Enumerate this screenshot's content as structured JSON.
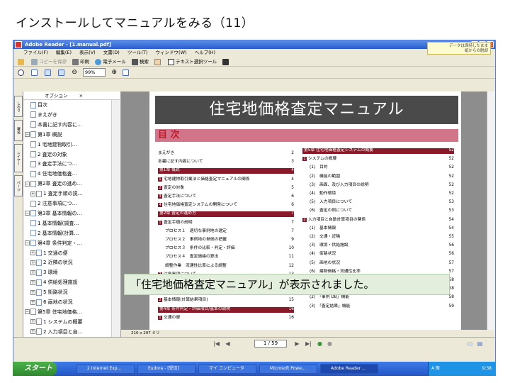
{
  "heading": "インストールしてマニュアルをみる（11）",
  "window": {
    "title": "Adobe Reader - [1.manual.pdf]",
    "menu": [
      "ファイル(F)",
      "編集(E)",
      "表示(V)",
      "文書(D)",
      "ツール(T)",
      "ウィンドウ(W)",
      "ヘルプ(H)"
    ],
    "toolbar1": [
      "コピーを保存",
      "印刷",
      "電子メール",
      "検索",
      "テキスト選択ツール"
    ],
    "zoom": "99%",
    "data_note": "データは保持したまま\n紙からの脱却",
    "options_label": "オプション",
    "vertical_tabs": [
      "しおり",
      "署名",
      "レイヤー",
      "ページ"
    ]
  },
  "bookmarks": [
    {
      "label": "目次",
      "level": 1,
      "expander": ""
    },
    {
      "label": "まえがき",
      "level": 1,
      "expander": ""
    },
    {
      "label": "本書に記す内容に…",
      "level": 1,
      "expander": ""
    },
    {
      "label": "第1章 概説",
      "level": 0,
      "expander": "⊟"
    },
    {
      "label": "1 宅地建物取引…",
      "level": 1,
      "expander": ""
    },
    {
      "label": "2 査定の対象",
      "level": 1,
      "expander": ""
    },
    {
      "label": "3 査定手法につ…",
      "level": 1,
      "expander": ""
    },
    {
      "label": "4 住宅地価格査…",
      "level": 1,
      "expander": ""
    },
    {
      "label": "第2章 査定の進め…",
      "level": 0,
      "expander": "⊟"
    },
    {
      "label": "1 査定手順の説…",
      "level": 1,
      "expander": "⊞"
    },
    {
      "label": "2 注意事項につ…",
      "level": 1,
      "expander": ""
    },
    {
      "label": "第3章 基本情報の…",
      "level": 0,
      "expander": "⊟"
    },
    {
      "label": "1 基本情報(調査…",
      "level": 1,
      "expander": ""
    },
    {
      "label": "2 基本情報(計算…",
      "level": 1,
      "expander": ""
    },
    {
      "label": "第4章 条件判定・…",
      "level": 0,
      "expander": "⊟"
    },
    {
      "label": "1 交通の便",
      "level": 1,
      "expander": "⊞"
    },
    {
      "label": "2 近隣の状況",
      "level": 1,
      "expander": "⊞"
    },
    {
      "label": "3 環境",
      "level": 1,
      "expander": "⊞"
    },
    {
      "label": "4 供給処理施設",
      "level": 1,
      "expander": "⊞"
    },
    {
      "label": "5 街路状況",
      "level": 1,
      "expander": "⊞"
    },
    {
      "label": "6 画地の状況",
      "level": 1,
      "expander": "⊞"
    },
    {
      "label": "第5章 住宅地価格…",
      "level": 0,
      "expander": "⊟"
    },
    {
      "label": "1 システムの概要",
      "level": 1,
      "expander": "⊞"
    },
    {
      "label": "2 入力項目と自…",
      "level": 1,
      "expander": "⊞"
    }
  ],
  "document": {
    "title": "住宅地価格査定マニュアル",
    "toc_heading": "目 次",
    "toc_left": [
      {
        "type": "item",
        "text": "まえがき",
        "page": "2"
      },
      {
        "type": "item",
        "text": "本書に記す内容について",
        "page": "3"
      },
      {
        "type": "chapter",
        "text": "第1章 概説",
        "page": "4"
      },
      {
        "type": "sub",
        "num": "1",
        "text": "宅地建物取引業法と価格査定マニュアルの関係",
        "page": "4"
      },
      {
        "type": "sub",
        "num": "2",
        "text": "査定の対象",
        "page": "5"
      },
      {
        "type": "sub",
        "num": "3",
        "text": "査定手法について",
        "page": "6"
      },
      {
        "type": "sub",
        "num": "4",
        "text": "住宅地価格査定システムの開発について",
        "page": "6"
      },
      {
        "type": "chapter",
        "text": "第2章 査定の進め方",
        "page": "7"
      },
      {
        "type": "sub",
        "num": "1",
        "text": "査定手順の説明",
        "page": "7"
      },
      {
        "type": "item",
        "text": "プロセス１　適切な事例地の選定",
        "page": "7"
      },
      {
        "type": "item",
        "text": "プロセス２　事例地の単価の把握",
        "page": "9"
      },
      {
        "type": "item",
        "text": "プロセス３　条件の比較・判定・評価",
        "page": "10"
      },
      {
        "type": "item",
        "text": "プロセス４　査定価格の算出",
        "page": "11"
      },
      {
        "type": "item",
        "text": "調整作業　流通性比率による調整",
        "page": "12"
      },
      {
        "type": "sub",
        "num": "2",
        "text": "注意事項について",
        "page": "13"
      },
      {
        "type": "chapter",
        "text": "第3章 基本情報の説明",
        "page": "14"
      },
      {
        "type": "sub",
        "num": "1",
        "text": "基本情報(調査項目)",
        "page": "14"
      },
      {
        "type": "sub",
        "num": "2",
        "text": "基本情報(計算結果項目)",
        "page": "15"
      },
      {
        "type": "chapter",
        "text": "第4章 条件判定・評価項目/基準の説明",
        "page": "16"
      },
      {
        "type": "sub",
        "num": "1",
        "text": "交通の便",
        "page": "16"
      }
    ],
    "toc_right": [
      {
        "type": "chapter",
        "text": "第5章 住宅地価格査定システムの概要",
        "page": "52"
      },
      {
        "type": "sub",
        "num": "1",
        "text": "システムの概要",
        "page": "52"
      },
      {
        "type": "item",
        "text": "(1)　目的",
        "page": "52"
      },
      {
        "type": "item",
        "text": "(2)　機能の範囲",
        "page": "52"
      },
      {
        "type": "item",
        "text": "(3)　画面、及び入力項目の説明",
        "page": "52"
      },
      {
        "type": "item",
        "text": "(4)　動作環境",
        "page": "52"
      },
      {
        "type": "item",
        "text": "(5)　入力項目について",
        "page": "53"
      },
      {
        "type": "item",
        "text": "(6)　査定の例について",
        "page": "53"
      },
      {
        "type": "sub",
        "num": "2",
        "text": "入力項目と自動計算項目の関係",
        "page": "54"
      },
      {
        "type": "item",
        "text": "(1)　基本情報",
        "page": "54"
      },
      {
        "type": "item",
        "text": "(2)　交通・近隣",
        "page": "55"
      },
      {
        "type": "item",
        "text": "(3)　環境・供給施設",
        "page": "56"
      },
      {
        "type": "item",
        "text": "(4)　街路状況",
        "page": "56"
      },
      {
        "type": "item",
        "text": "(5)　画地の状況",
        "page": "57"
      },
      {
        "type": "item",
        "text": "(6)　建物価格・流通性比率",
        "page": "57"
      },
      {
        "type": "sub",
        "num": "3",
        "text": "補助機能のご紹介",
        "page": "58"
      },
      {
        "type": "item",
        "text": "(1)　「条件記入用紙」印刷機能",
        "page": "58"
      },
      {
        "type": "item",
        "text": "(2)　「事例 DB」機能",
        "page": "58"
      },
      {
        "type": "item",
        "text": "(3)　「査定結果」機能",
        "page": "59"
      }
    ]
  },
  "caption": "「住宅地価格査定マニュアル」が表示されました。",
  "status": {
    "page_size": "210 x 297 ミリ",
    "page_indicator": "1 / 59"
  },
  "taskbar": {
    "start": "スタート",
    "tasks": [
      "2 Internet Exp...",
      "Eudora - [受信]",
      "マイ コンピュータ",
      "Microsoft Powe...",
      "Adobe Reader ..."
    ],
    "active_index": 4,
    "tray_text": "A 般",
    "time": "9:38"
  }
}
